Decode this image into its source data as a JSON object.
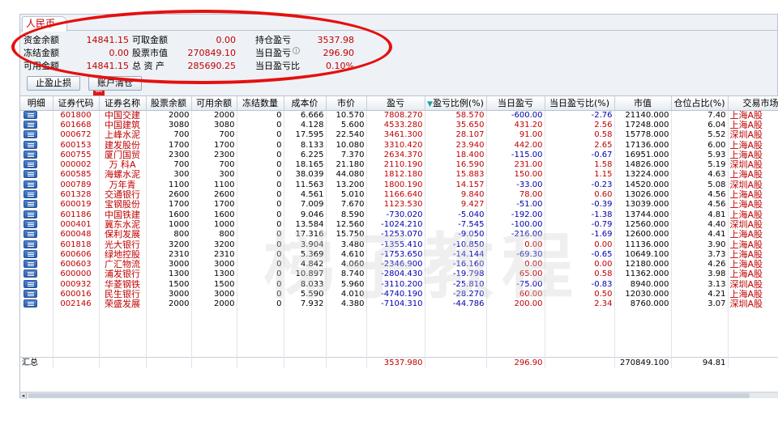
{
  "tab": {
    "label": "人民币"
  },
  "summary": {
    "row1": [
      {
        "label": "资金余额",
        "value": "14841.15"
      },
      {
        "label": "可取金额",
        "value": "0.00"
      },
      {
        "label": "持仓盈亏",
        "value": "3537.98"
      }
    ],
    "row2": [
      {
        "label": "冻结金额",
        "value": "0.00"
      },
      {
        "label": "股票市值",
        "value": "270849.10"
      },
      {
        "label": "当日盈亏",
        "value": "296.90"
      }
    ],
    "row3": [
      {
        "label": "可用金额",
        "value": "14841.15"
      },
      {
        "label": "总 资 产",
        "value": "285690.25"
      },
      {
        "label": "当日盈亏比",
        "value": "0.10%"
      }
    ]
  },
  "buttons": {
    "stop": "止盈止损",
    "statement": "账户清仓",
    "new_badge": "新"
  },
  "watermark": "梯子教程",
  "columns": [
    "明细",
    "证券代码",
    "证券名称",
    "股票余额",
    "可用余额",
    "冻结数量",
    "成本价",
    "市价",
    "盈亏",
    "盈亏比例(%)",
    "当日盈亏",
    "当日盈亏比(%)",
    "市值",
    "仓位占比(%)",
    "交易市场"
  ],
  "rows": [
    [
      "601800",
      "中国交建",
      "2000",
      "2000",
      "0",
      "6.666",
      "10.570",
      "7808.270",
      "58.570",
      "-600.00",
      "-2.76",
      "21140.000",
      "7.40",
      "上海A股"
    ],
    [
      "601668",
      "中国建筑",
      "3080",
      "3080",
      "0",
      "4.128",
      "5.600",
      "4533.280",
      "35.650",
      "431.20",
      "2.56",
      "17248.000",
      "6.04",
      "上海A股"
    ],
    [
      "000672",
      "上峰水泥",
      "700",
      "700",
      "0",
      "17.595",
      "22.540",
      "3461.300",
      "28.107",
      "91.00",
      "0.58",
      "15778.000",
      "5.52",
      "深圳A股"
    ],
    [
      "600153",
      "建发股份",
      "1700",
      "1700",
      "0",
      "8.133",
      "10.080",
      "3310.420",
      "23.940",
      "442.00",
      "2.65",
      "17136.000",
      "6.00",
      "上海A股"
    ],
    [
      "600755",
      "厦门国贸",
      "2300",
      "2300",
      "0",
      "6.225",
      "7.370",
      "2634.370",
      "18.400",
      "-115.00",
      "-0.67",
      "16951.000",
      "5.93",
      "上海A股"
    ],
    [
      "000002",
      "万 科A",
      "700",
      "700",
      "0",
      "18.165",
      "21.180",
      "2110.190",
      "16.590",
      "231.00",
      "1.58",
      "14826.000",
      "5.19",
      "深圳A股"
    ],
    [
      "600585",
      "海螺水泥",
      "300",
      "300",
      "0",
      "38.039",
      "44.080",
      "1812.180",
      "15.883",
      "150.00",
      "1.15",
      "13224.000",
      "4.63",
      "上海A股"
    ],
    [
      "000789",
      "万年青",
      "1100",
      "1100",
      "0",
      "11.563",
      "13.200",
      "1800.190",
      "14.157",
      "-33.00",
      "-0.23",
      "14520.000",
      "5.08",
      "深圳A股"
    ],
    [
      "601328",
      "交通银行",
      "2600",
      "2600",
      "0",
      "4.561",
      "5.010",
      "1166.640",
      "9.840",
      "78.00",
      "0.60",
      "13026.000",
      "4.56",
      "上海A股"
    ],
    [
      "600019",
      "宝钢股份",
      "1700",
      "1700",
      "0",
      "7.009",
      "7.670",
      "1123.530",
      "9.427",
      "-51.00",
      "-0.39",
      "13039.000",
      "4.56",
      "上海A股"
    ],
    [
      "601186",
      "中国铁建",
      "1600",
      "1600",
      "0",
      "9.046",
      "8.590",
      "-730.020",
      "-5.040",
      "-192.00",
      "-1.38",
      "13744.000",
      "4.81",
      "上海A股"
    ],
    [
      "000401",
      "冀东水泥",
      "1000",
      "1000",
      "0",
      "13.584",
      "12.560",
      "-1024.210",
      "-7.545",
      "-100.00",
      "-0.79",
      "12560.000",
      "4.40",
      "深圳A股"
    ],
    [
      "600048",
      "保利发展",
      "800",
      "800",
      "0",
      "17.316",
      "15.750",
      "-1253.070",
      "-9.050",
      "-216.00",
      "-1.69",
      "12600.000",
      "4.41",
      "上海A股"
    ],
    [
      "601818",
      "光大银行",
      "3200",
      "3200",
      "0",
      "3.904",
      "3.480",
      "-1355.410",
      "-10.850",
      "0.00",
      "0.00",
      "11136.000",
      "3.90",
      "上海A股"
    ],
    [
      "600606",
      "绿地控股",
      "2310",
      "2310",
      "0",
      "5.369",
      "4.610",
      "-1753.650",
      "-14.144",
      "-69.30",
      "-0.65",
      "10649.100",
      "3.73",
      "上海A股"
    ],
    [
      "600603",
      "广汇物流",
      "3000",
      "3000",
      "0",
      "4.842",
      "4.060",
      "-2346.900",
      "-16.160",
      "0.00",
      "0.00",
      "12180.000",
      "4.26",
      "上海A股"
    ],
    [
      "600000",
      "浦发银行",
      "1300",
      "1300",
      "0",
      "10.897",
      "8.740",
      "-2804.430",
      "-19.798",
      "65.00",
      "0.58",
      "11362.000",
      "3.98",
      "上海A股"
    ],
    [
      "000932",
      "华菱钢铁",
      "1500",
      "1500",
      "0",
      "8.033",
      "5.960",
      "-3110.200",
      "-25.810",
      "-75.00",
      "-0.83",
      "8940.000",
      "3.13",
      "深圳A股"
    ],
    [
      "600016",
      "民生银行",
      "3000",
      "3000",
      "0",
      "5.590",
      "4.010",
      "-4740.190",
      "-28.270",
      "60.00",
      "0.50",
      "12030.000",
      "4.21",
      "上海A股"
    ],
    [
      "002146",
      "荣盛发展",
      "2000",
      "2000",
      "0",
      "7.932",
      "4.380",
      "-7104.310",
      "-44.786",
      "200.00",
      "2.34",
      "8760.000",
      "3.07",
      "深圳A股"
    ]
  ],
  "total": {
    "label": "汇总",
    "pnl": "3537.980",
    "day_pnl": "296.90",
    "market_value": "270849.100",
    "position": "94.81"
  }
}
